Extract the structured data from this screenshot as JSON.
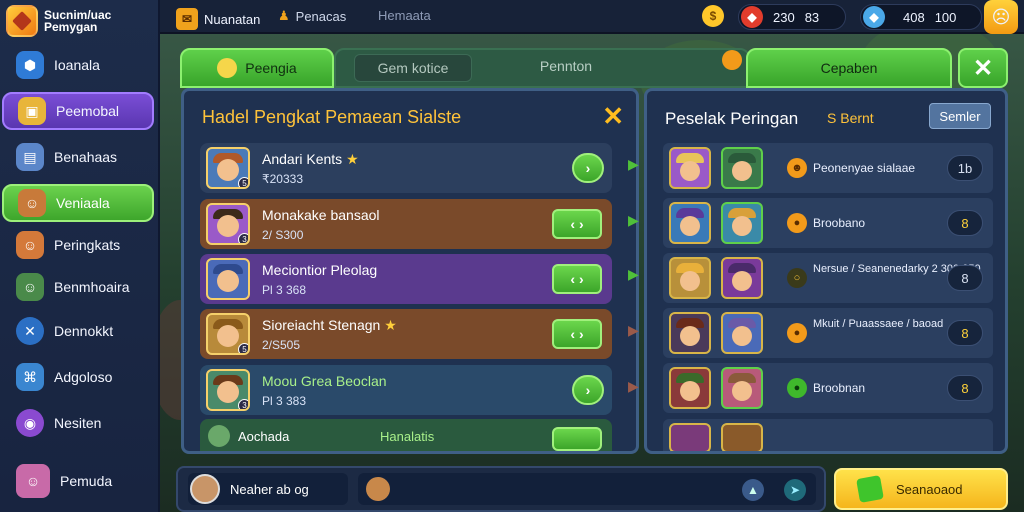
{
  "app": {
    "logo_line1": "Sucnim/uac",
    "logo_line2": "Pemygan"
  },
  "sidebar": {
    "items": [
      {
        "label": "Ioanala",
        "icon": "shield-icon"
      },
      {
        "label": "Peemobal",
        "icon": "chest-icon",
        "state": "selected-purple"
      },
      {
        "label": "Benahaas",
        "icon": "scroll-icon"
      },
      {
        "label": "Veniaala",
        "icon": "hero-icon",
        "state": "selected-green"
      },
      {
        "label": "Peringkats",
        "icon": "hero-icon"
      },
      {
        "label": "Benmhoaira",
        "icon": "hero-icon"
      },
      {
        "label": "Dennokkt",
        "icon": "crossed-swords-icon"
      },
      {
        "label": "Adgoloso",
        "icon": "map-icon"
      },
      {
        "label": "Nesiten",
        "icon": "orb-icon"
      },
      {
        "label": "Pemuda",
        "icon": "avatar-icon"
      }
    ]
  },
  "topbar": {
    "mail_label": "Nuanatan",
    "people_label": "Penacas",
    "third_label": "Hemaata",
    "gold_value": "230",
    "gems_value": "83",
    "wallet_value1": "408",
    "wallet_value2": "100"
  },
  "tabs": {
    "tab1": "Peengia",
    "tab2": "Gem kotice",
    "tab3": "Pennton",
    "tab4": "Cepaben",
    "close": "✕"
  },
  "left_panel": {
    "title": "Hadel Pengkat Pemaean Sialste",
    "rows": [
      {
        "name": "Andari Kents",
        "sub": "₹20333",
        "button": "›",
        "color": "#2c3f5e",
        "hat": "#b0592a"
      },
      {
        "name": "Monakake bansaol",
        "sub": "2/ S300",
        "button": "‹ ›",
        "color": "#7a4a2a",
        "hat": "#3c2a1a"
      },
      {
        "name": "Meciontior Pleolag",
        "sub": "Pl 3 368",
        "button": "‹ ›",
        "color": "#5a3a8e",
        "hat": "#2e4a8e"
      },
      {
        "name": "Sioreiacht Stenagn",
        "sub": "2/S505",
        "button": "‹ ›",
        "color": "#7a4a2a",
        "hat": "#8a5a1a"
      },
      {
        "name": "Moou Grea Beoclan",
        "sub": "Pl 3 383",
        "button": "›",
        "color": "#2a4a6a",
        "hat": "#6a3a1a"
      },
      {
        "name": "Aochada",
        "sub": "Hanalatis",
        "button": "",
        "color": "#2a5a3e",
        "hat": "#3a7a3a"
      }
    ]
  },
  "right_panel": {
    "title": "Peselak Peringan",
    "subtitle": "S Bernt",
    "top_button": "Semler",
    "rows": [
      {
        "text": "Peonenyae sialaae",
        "value": "1b"
      },
      {
        "text": "Broobano",
        "value": "8"
      },
      {
        "text": "Nersue / Seanenedarky 2 300 050",
        "value": "8"
      },
      {
        "text": "Mkuit / Puaassaee / baoad",
        "value": "8"
      },
      {
        "text": "Broobnan",
        "value": "8"
      }
    ]
  },
  "bottom": {
    "chat_user": "Neaher ab og",
    "big_button": "Seanaoaod"
  },
  "colors": {
    "accent_green": "#4fc03a",
    "gold": "#ffc33a",
    "panel": "#1f3150"
  }
}
